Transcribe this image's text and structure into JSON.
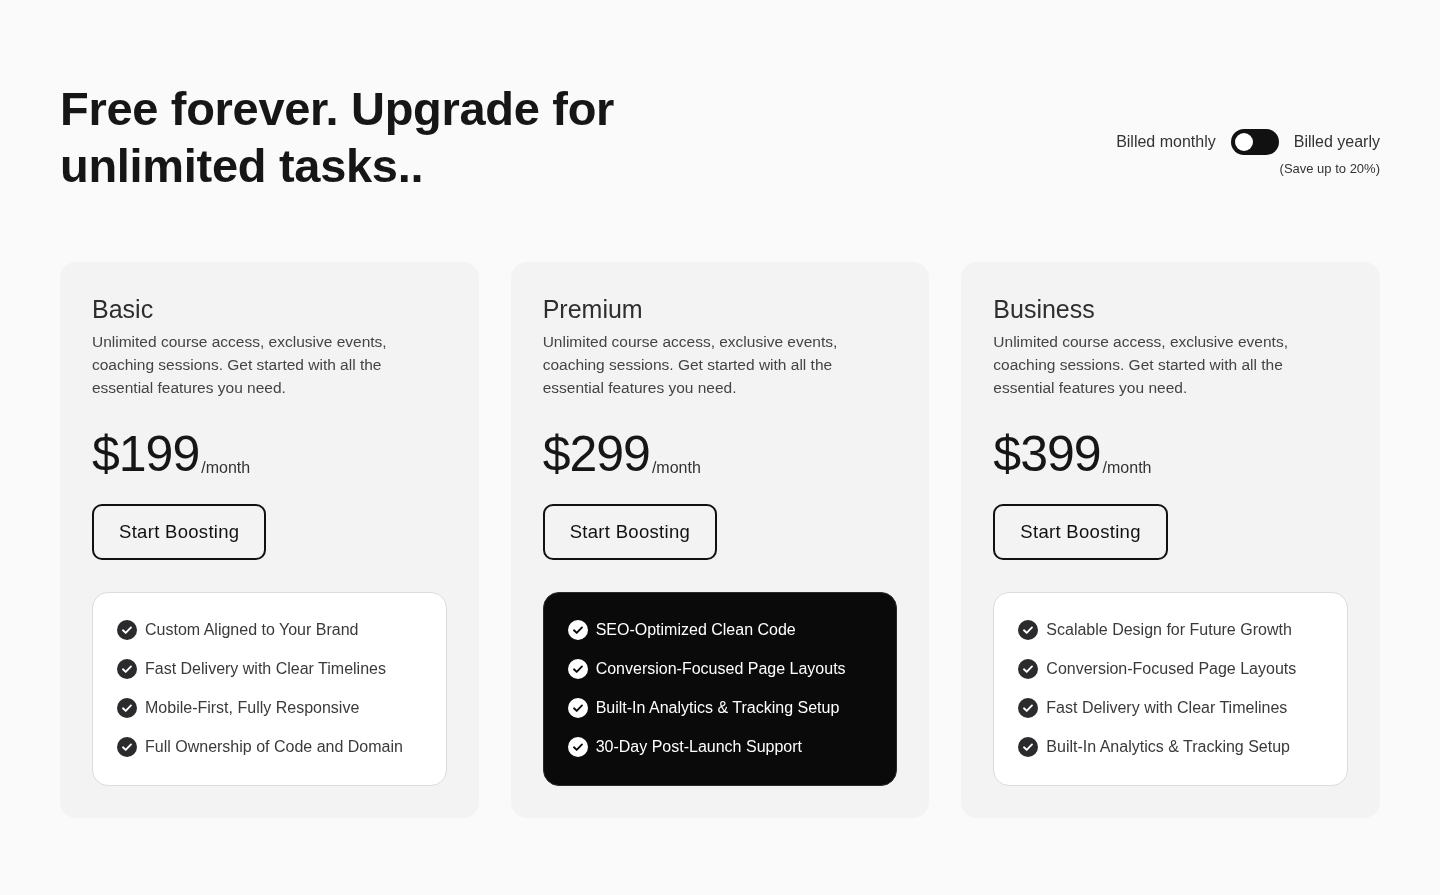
{
  "header": {
    "title": "Free forever. Upgrade for unlimited tasks..",
    "billing": {
      "monthly_label": "Billed monthly",
      "toggle": {
        "on": false
      },
      "yearly_label": "Billed yearly",
      "savings_note": "(Save up to 20%)"
    }
  },
  "plans": [
    {
      "name": "Basic",
      "description": "Unlimited course access, exclusive events, coaching sessions. Get started with all the essential features you need.",
      "price": "$199",
      "period": "/month",
      "button": "Start Boosting",
      "highlighted": false,
      "features": [
        "Custom Aligned to Your Brand",
        "Fast Delivery with Clear Timelines",
        "Mobile-First, Fully Responsive",
        "Full Ownership of Code and Domain"
      ]
    },
    {
      "name": "Premium",
      "description": "Unlimited course access, exclusive events, coaching sessions. Get started with all the essential features you need.",
      "price": "$299",
      "period": "/month",
      "button": "Start Boosting",
      "highlighted": true,
      "features": [
        "SEO-Optimized Clean Code",
        "Conversion-Focused Page Layouts",
        "Built-In Analytics & Tracking Setup",
        "30-Day Post-Launch Support"
      ]
    },
    {
      "name": "Business",
      "description": "Unlimited course access, exclusive events, coaching sessions. Get started with all the essential features you need.",
      "price": "$399",
      "period": "/month",
      "button": "Start Boosting",
      "highlighted": false,
      "features": [
        "Scalable Design for Future Growth",
        "Conversion-Focused Page Layouts",
        "Fast Delivery with Clear Timelines",
        "Built-In Analytics & Tracking Setup"
      ]
    }
  ]
}
